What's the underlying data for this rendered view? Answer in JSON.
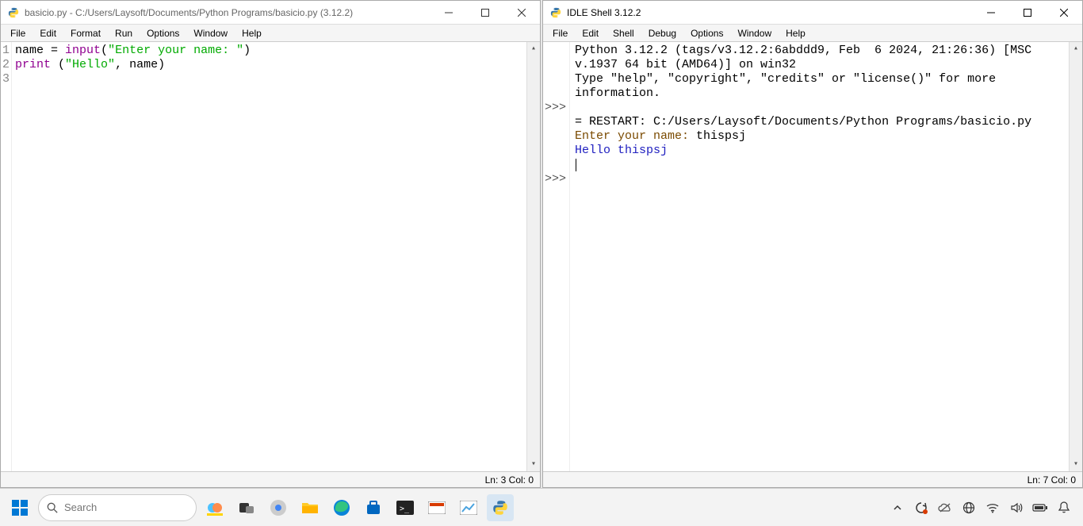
{
  "editor": {
    "title": "basicio.py - C:/Users/Laysoft/Documents/Python Programs/basicio.py (3.12.2)",
    "menu": [
      "File",
      "Edit",
      "Format",
      "Run",
      "Options",
      "Window",
      "Help"
    ],
    "line_numbers": [
      "1",
      "2",
      "3"
    ],
    "code": {
      "l1_name": "name",
      "l1_eq": " = ",
      "l1_input": "input",
      "l1_open": "(",
      "l1_str": "\"Enter your name: \"",
      "l1_close": ")",
      "l2_print": "print",
      "l2_sp": " ",
      "l2_open": "(",
      "l2_str": "\"Hello\"",
      "l2_comma": ", ",
      "l2_name": "name",
      "l2_close": ")"
    },
    "status": "Ln: 3   Col: 0"
  },
  "shell": {
    "title": "IDLE Shell 3.12.2",
    "menu": [
      "File",
      "Edit",
      "Shell",
      "Debug",
      "Options",
      "Window",
      "Help"
    ],
    "banner1": "Python 3.12.2 (tags/v3.12.2:6abddd9, Feb  6 2024, 21:26:36) [MSC v.1937 64 bit (AMD64)] on win32",
    "banner2": "Type \"help\", \"copyright\", \"credits\" or \"license()\" for more information.",
    "prompt": ">>>",
    "blank": "",
    "restart": "= RESTART: C:/Users/Laysoft/Documents/Python Programs/basicio.py",
    "inprompt": "Enter your name: ",
    "input_val": "thispsj",
    "output": "Hello thispsj",
    "status": "Ln: 7   Col: 0"
  },
  "taskbar": {
    "search_placeholder": "Search"
  }
}
